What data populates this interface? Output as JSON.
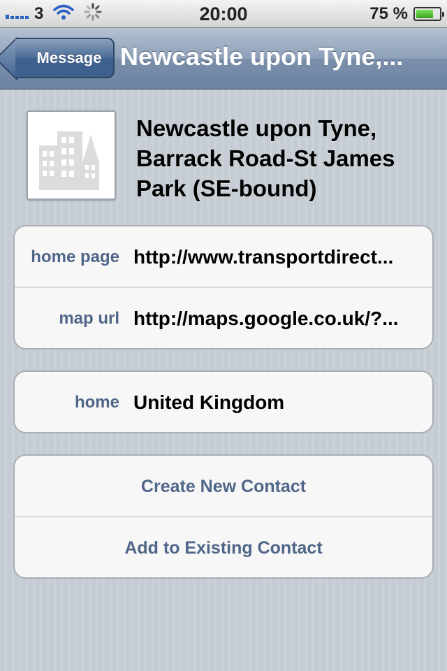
{
  "status_bar": {
    "carrier": "3",
    "time": "20:00",
    "battery_percent": "75 %",
    "battery_level": 0.75
  },
  "nav": {
    "back_label": "Message",
    "title": "Newcastle upon Tyne,..."
  },
  "contact": {
    "name": "Newcastle upon Tyne, Barrack Road-St James Park (SE-bound)",
    "photo_icon": "building-icon"
  },
  "fields": [
    {
      "label": "home page",
      "value": "http://www.transportdirect..."
    },
    {
      "label": "map url",
      "value": "http://maps.google.co.uk/?..."
    }
  ],
  "address": {
    "label": "home",
    "value": "United Kingdom"
  },
  "actions": {
    "create_new": "Create New Contact",
    "add_existing": "Add to Existing Contact"
  }
}
